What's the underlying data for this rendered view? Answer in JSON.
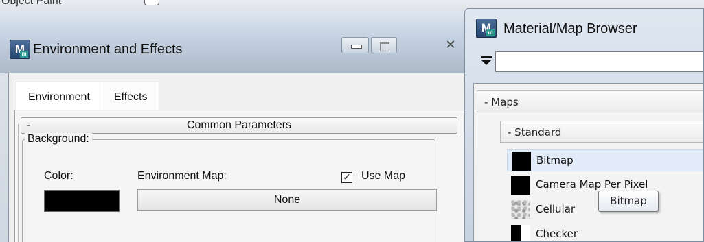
{
  "background_app": {
    "label": "Object Paint",
    "dropdown": "▾"
  },
  "environment_window": {
    "title": "Environment and Effects",
    "icon": {
      "glyph": "M",
      "sub": "m"
    },
    "minimize_glyph": "",
    "close_glyph": "✕",
    "tabs": [
      {
        "label": "Environment",
        "active": true
      },
      {
        "label": "Effects",
        "active": false
      }
    ],
    "rollout": {
      "toggle": "-",
      "title": "Common Parameters"
    },
    "background_group": {
      "legend": "Background:",
      "color_label": "Color:",
      "color_value": "#000000",
      "env_map_label": "Environment Map:",
      "use_map_label": "Use Map",
      "use_map_checked": true,
      "use_map_check": "✓",
      "map_button_label": "None"
    }
  },
  "material_browser": {
    "title": "Material/Map Browser",
    "icon": {
      "glyph": "M",
      "sub": "m"
    },
    "filter": {
      "value": "",
      "icon": "filter-funnel-icon"
    },
    "categories": {
      "maps": "- Maps",
      "standard": "- Standard"
    },
    "items": [
      {
        "label": "Bitmap",
        "thumb": "black"
      },
      {
        "label": "Camera Map Per Pixel",
        "thumb": "black"
      },
      {
        "label": "Cellular",
        "thumb": "cellular"
      },
      {
        "label": "Checker",
        "thumb": "checker"
      }
    ],
    "tooltip": "Bitmap"
  },
  "colors": {
    "titlebar": "#c6d3e2",
    "hover": "#e2ecf8",
    "panel": "#f0f0f0"
  }
}
